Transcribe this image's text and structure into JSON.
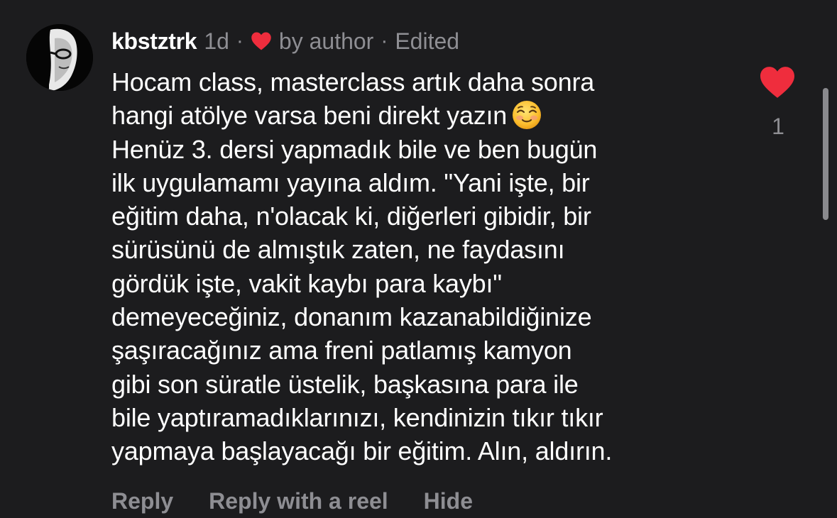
{
  "comment": {
    "username": "kbstztrk",
    "time": "1d",
    "liked_by": "by author",
    "edited": "Edited",
    "separator": "·",
    "lines": [
      "Hocam class, masterclass artık daha sonra",
      "hangi atölye varsa beni direkt yazın",
      "Henüz 3. dersi yapmadık bile ve ben bugün",
      "ilk uygulamamı yayına aldım. \"Yani işte, bir",
      "eğitim daha, n'olacak ki, diğerleri gibidir, bir",
      "sürüsünü de almıştık zaten, ne faydasını",
      "gördük işte, vakit kaybı para kaybı\"",
      "demeyeceğiniz, donanım kazanabildiğinize",
      "şaşıracağınız ama freni patlamış kamyon",
      "gibi son süratle üstelik, başkasına para ile",
      "bile yaptıramadıklarınızı, kendinizin tıkır tıkır",
      "yapmaya başlayacağı bir eğitim. Alın, aldırın."
    ],
    "emoji": "smiling-face-emoji",
    "like_count": "1"
  },
  "actions": {
    "reply": "Reply",
    "reply_reel": "Reply with a reel",
    "hide": "Hide"
  },
  "colors": {
    "background": "#1c1c1e",
    "text": "#ffffff",
    "muted": "#8e8e93",
    "heart": "#ef2d3d"
  },
  "icons": {
    "author_like": "heart-icon",
    "like_button": "heart-icon"
  }
}
